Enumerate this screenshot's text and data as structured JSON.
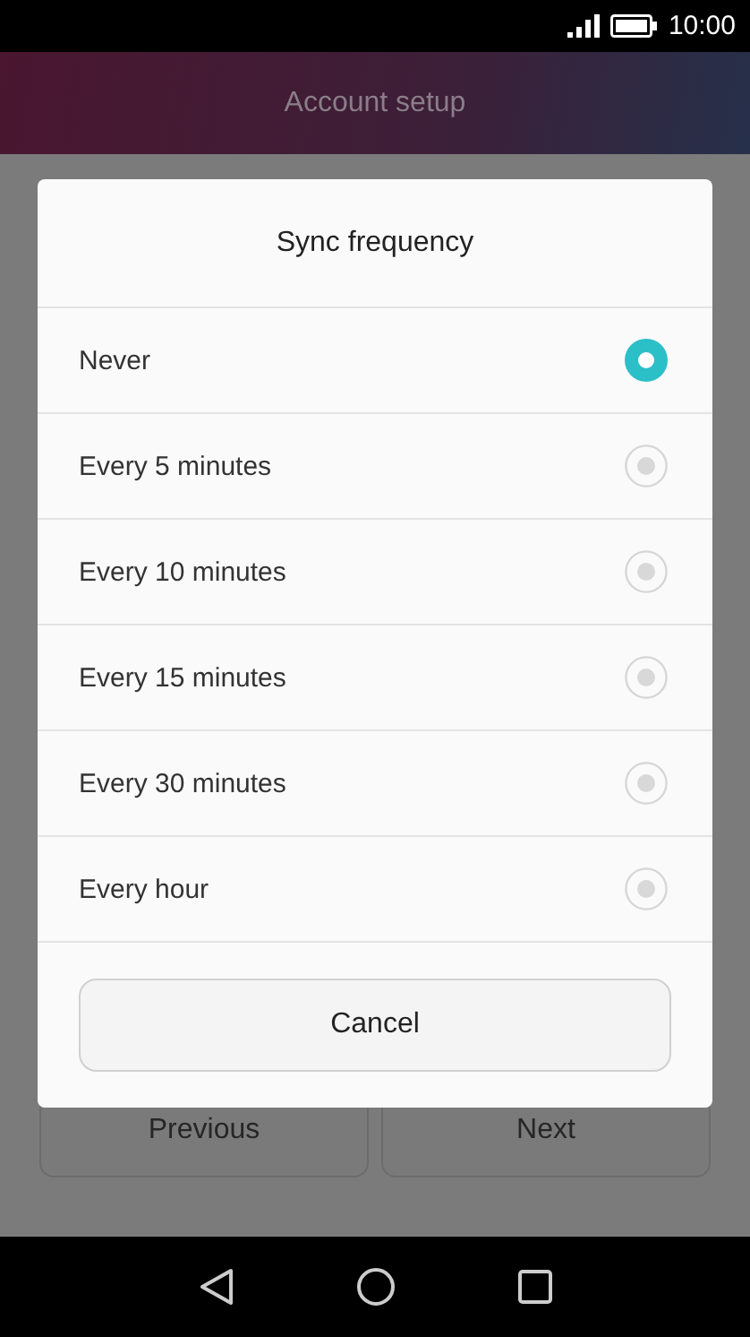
{
  "status_bar": {
    "time": "10:00"
  },
  "header": {
    "title": "Account setup"
  },
  "background_buttons": [
    "Previous",
    "Next"
  ],
  "dialog": {
    "title": "Sync frequency",
    "options": [
      {
        "label": "Never",
        "selected": true
      },
      {
        "label": "Every 5 minutes",
        "selected": false
      },
      {
        "label": "Every 10 minutes",
        "selected": false
      },
      {
        "label": "Every 15 minutes",
        "selected": false
      },
      {
        "label": "Every 30 minutes",
        "selected": false
      },
      {
        "label": "Every hour",
        "selected": false
      }
    ],
    "cancel": "Cancel"
  }
}
